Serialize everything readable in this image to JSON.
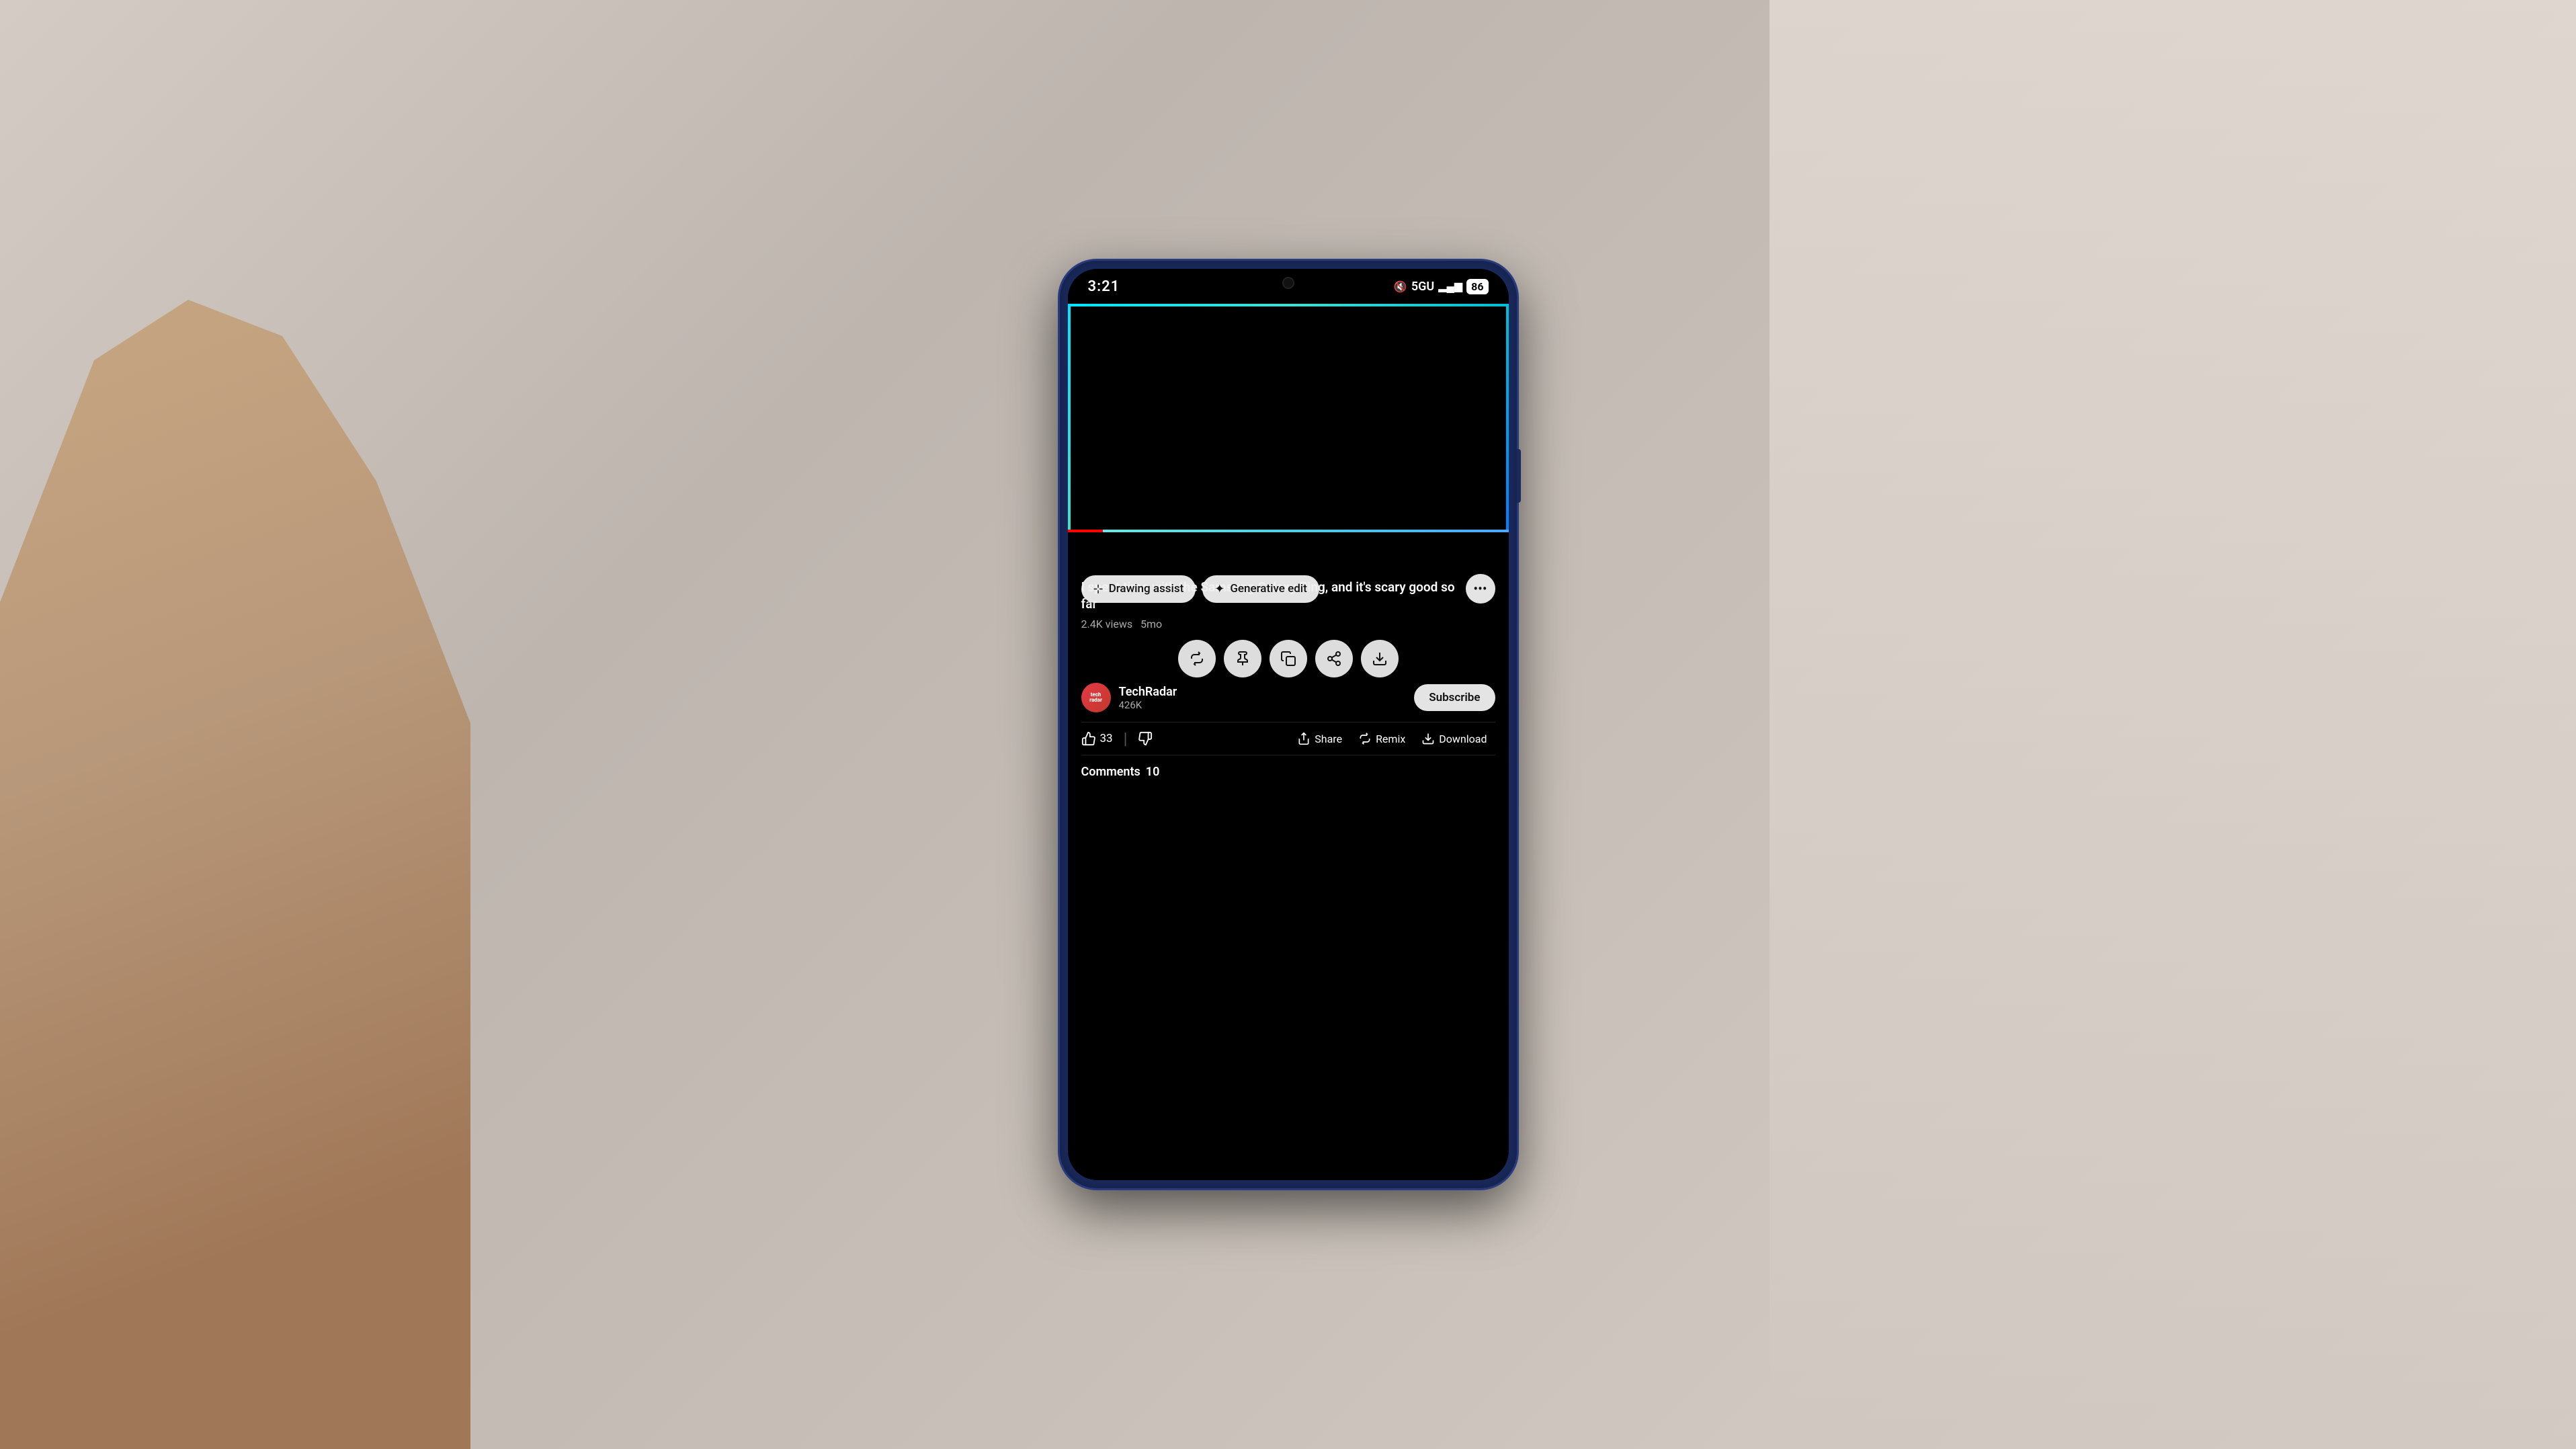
{
  "background": {
    "color": "#c8c0b8"
  },
  "status_bar": {
    "time": "3:21",
    "mute_icon": "🔇",
    "network": "5GU",
    "signal_bars": "▂▄▆",
    "battery": "86"
  },
  "video": {
    "progress_percent": 8,
    "glow_colors": [
      "#00e5ff",
      "#40e0d0",
      "#0080ff"
    ]
  },
  "title": "I spent time with the Samsung Galaxy Ring, and it's scary good so far",
  "meta": {
    "views": "2.4K views",
    "time_ago": "5mo"
  },
  "edit_toolbar": {
    "drawing_assist_label": "Drawing assist",
    "generative_edit_label": "Generative edit",
    "more_label": "⋯"
  },
  "action_toolbar": {
    "remix_icon": "↻",
    "pin_icon": "📌",
    "copy_icon": "⧉",
    "share_icon": "↗",
    "download_icon": "⬇"
  },
  "channel": {
    "name": "TechRadar",
    "subscribers": "426K",
    "avatar_text": "tech\nradar",
    "subscribe_label": "Subscribe"
  },
  "actions": {
    "like_count": "33",
    "share_label": "Share",
    "remix_label": "Remix",
    "download_label": "Download"
  },
  "comments": {
    "label": "Comments",
    "count": "10"
  }
}
